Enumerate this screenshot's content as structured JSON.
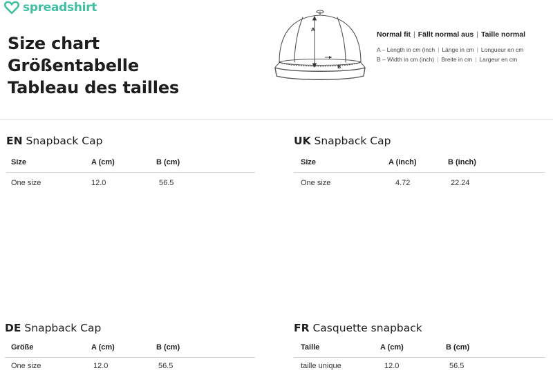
{
  "brand": {
    "name": "spreadshirt",
    "color": "#3fbfa0"
  },
  "titles": [
    "Size chart",
    "Größentabelle",
    "Tableau des tailles"
  ],
  "diagram": {
    "label_a": "A",
    "label_b": "B"
  },
  "legend": {
    "fit": [
      "Normal fit",
      "Fällt normal aus",
      "Taille normal"
    ],
    "row_a": [
      "A – Length in cm (inch",
      "Länge in cm",
      "Longueur en cm"
    ],
    "row_b": [
      "B – Width in cm (inch)",
      "Breite in cm",
      "Largeur en cm"
    ]
  },
  "sections": [
    {
      "code": "EN",
      "name": "Snapback Cap",
      "headers": [
        "Size",
        "A (cm)",
        "B (cm)"
      ],
      "row": [
        "One size",
        "12.0",
        "56.5"
      ]
    },
    {
      "code": "UK",
      "name": "Snapback Cap",
      "headers": [
        "Size",
        "A (inch)",
        "B (inch)"
      ],
      "row": [
        "One size",
        "4.72",
        "22.24"
      ]
    },
    {
      "code": "DE",
      "name": "Snapback Cap",
      "headers": [
        "Größe",
        "A (cm)",
        "B (cm)"
      ],
      "row": [
        "One size",
        "12.0",
        "56.5"
      ]
    },
    {
      "code": "FR",
      "name": "Casquette snapback",
      "headers": [
        "Taille",
        "A (cm)",
        "B (cm)"
      ],
      "row": [
        "taille unique",
        "12.0",
        "56.5"
      ]
    }
  ]
}
